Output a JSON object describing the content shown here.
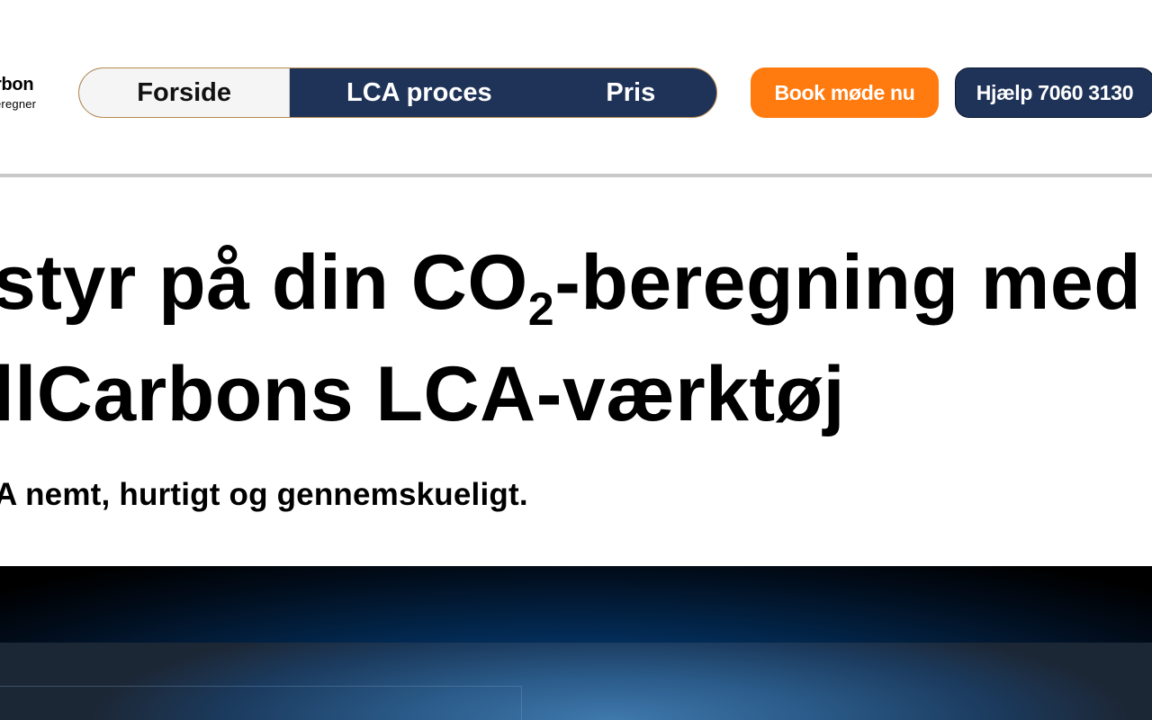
{
  "header": {
    "logo": {
      "name": "rbon",
      "tagline": "eregner"
    },
    "nav": [
      {
        "label": "Forside",
        "active": true
      },
      {
        "label": "LCA proces",
        "active": false
      },
      {
        "label": "Pris",
        "active": false
      }
    ],
    "book_button": "Book møde nu",
    "help_button": "Hjælp 7060 3130"
  },
  "hero": {
    "title_line1_before": "styr på din CO",
    "title_subscript": "2",
    "title_line1_after": "-beregning med",
    "title_line2": "llCarbons LCA-værktøj",
    "subtitle": "A nemt, hurtigt og gennemskueligt."
  },
  "colors": {
    "nav_bg": "#1f3358",
    "accent_orange": "#ff7a0f",
    "active_tab_bg": "#f5f5f5"
  }
}
